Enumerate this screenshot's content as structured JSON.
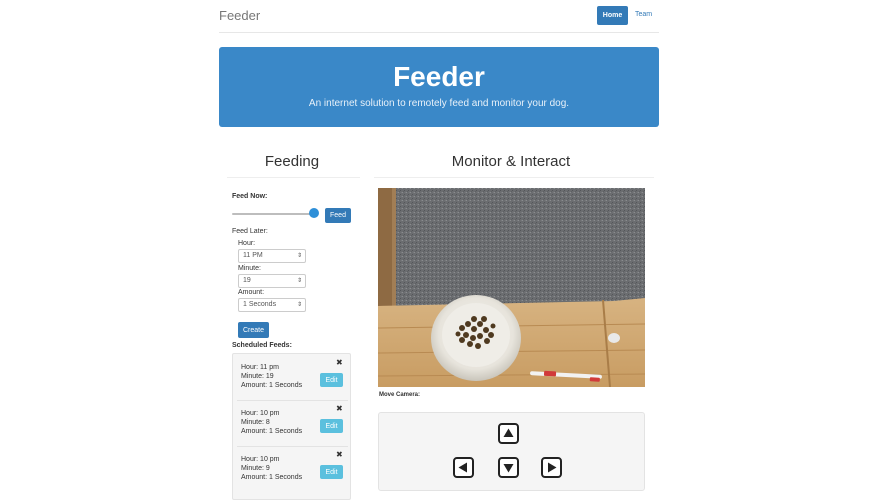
{
  "navbar": {
    "brand": "Feeder",
    "home_label": "Home",
    "team_label": "Team"
  },
  "jumbotron": {
    "title": "Feeder",
    "subtitle": "An internet solution to remotely feed and monitor your dog."
  },
  "feeding": {
    "heading": "Feeding",
    "feed_now_label": "Feed Now:",
    "slider_level_percent": 100,
    "feed_button": "Feed",
    "feed_later_label": "Feed Later:",
    "hour_label": "Hour:",
    "hour_value": "11 PM",
    "minute_label": "Minute:",
    "minute_value": "19",
    "amount_label": "Amount:",
    "amount_value": "1 Seconds",
    "create_button": "Create",
    "scheduled_label": "Scheduled Feeds:",
    "scheduled": [
      {
        "hour": "Hour: 11 pm",
        "minute": "Minute: 19",
        "amount": "Amount: 1 Seconds",
        "edit": "Edit"
      },
      {
        "hour": "Hour: 10 pm",
        "minute": "Minute: 8",
        "amount": "Amount: 1 Seconds",
        "edit": "Edit"
      },
      {
        "hour": "Hour: 10 pm",
        "minute": "Minute: 9",
        "amount": "Amount: 1 Seconds",
        "edit": "Edit"
      }
    ]
  },
  "monitor": {
    "heading": "Monitor & Interact",
    "move_camera_label": "Move Camera:"
  },
  "icons": {
    "close": "close-icon",
    "up": "arrow-up-icon",
    "down": "arrow-down-icon",
    "left": "arrow-left-icon",
    "right": "arrow-right-icon"
  },
  "colors": {
    "primary": "#337ab7",
    "jumbotron": "#3a88c8",
    "info": "#5bc0de",
    "slider_thumb": "#2e8fd8"
  }
}
